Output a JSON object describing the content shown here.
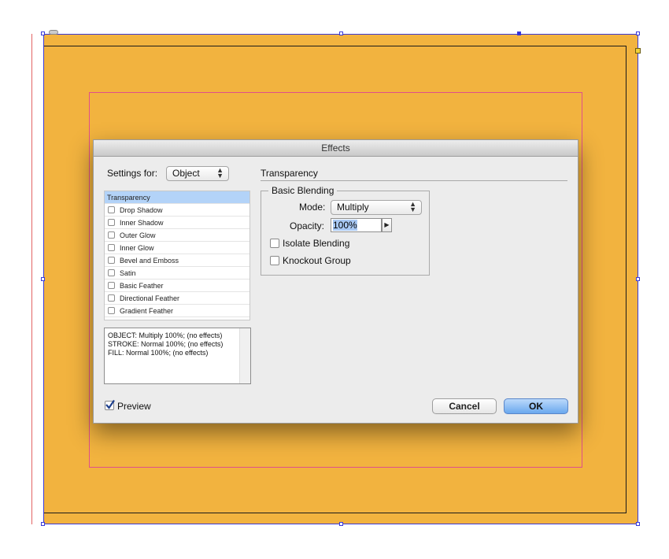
{
  "dialog": {
    "title": "Effects",
    "settings_for_label": "Settings for:",
    "settings_for_value": "Object",
    "section_title": "Transparency",
    "effects_list": [
      {
        "label": "Transparency",
        "selected": true
      },
      {
        "label": "Drop Shadow",
        "checked": false
      },
      {
        "label": "Inner Shadow",
        "checked": false
      },
      {
        "label": "Outer Glow",
        "checked": false
      },
      {
        "label": "Inner Glow",
        "checked": false
      },
      {
        "label": "Bevel and Emboss",
        "checked": false
      },
      {
        "label": "Satin",
        "checked": false
      },
      {
        "label": "Basic Feather",
        "checked": false
      },
      {
        "label": "Directional Feather",
        "checked": false
      },
      {
        "label": "Gradient Feather",
        "checked": false
      }
    ],
    "summary_lines": [
      "OBJECT: Multiply 100%; (no effects)",
      "STROKE: Normal 100%; (no effects)",
      "FILL: Normal 100%; (no effects)"
    ],
    "basic_blending": {
      "group_title": "Basic Blending",
      "mode_label": "Mode:",
      "mode_value": "Multiply",
      "opacity_label": "Opacity:",
      "opacity_value": "100%",
      "isolate_label": "Isolate Blending",
      "isolate_checked": false,
      "knockout_label": "Knockout Group",
      "knockout_checked": false
    },
    "preview_label": "Preview",
    "preview_checked": true,
    "cancel_label": "Cancel",
    "ok_label": "OK"
  },
  "colors": {
    "artwork_fill": "#f2b33f",
    "selection": "#3a3ad9",
    "margin_guide": "#e0508a",
    "ok_button": "#6aa8ee"
  }
}
